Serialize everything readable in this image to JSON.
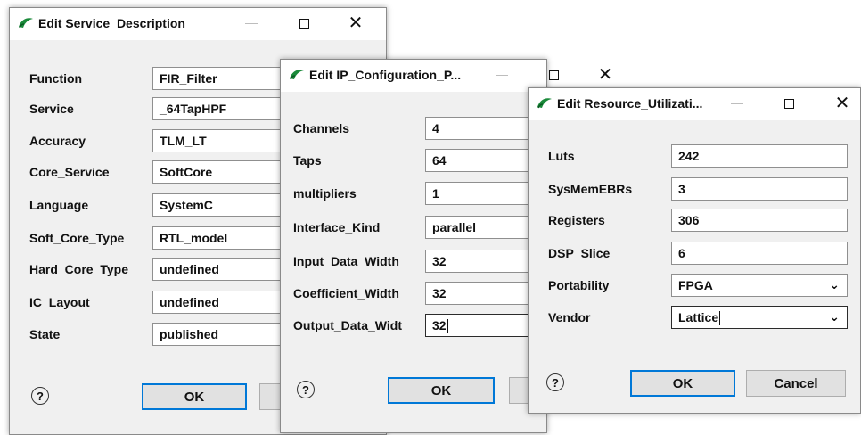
{
  "dialog1": {
    "title": "Edit Service_Description",
    "rows": [
      {
        "label": "Function",
        "value": "FIR_Filter"
      },
      {
        "label": "Service",
        "value": "_64TapHPF"
      },
      {
        "label": "Accuracy",
        "value": "TLM_LT"
      },
      {
        "label": "Core_Service",
        "value": "SoftCore"
      },
      {
        "label": "Language",
        "value": "SystemC"
      },
      {
        "label": "Soft_Core_Type",
        "value": "RTL_model"
      },
      {
        "label": "Hard_Core_Type",
        "value": "undefined"
      },
      {
        "label": "IC_Layout",
        "value": "undefined"
      },
      {
        "label": "State",
        "value": "published"
      }
    ],
    "help": "?",
    "ok_label": "OK"
  },
  "dialog2": {
    "title": "Edit IP_Configuration_P...",
    "rows": [
      {
        "label": "Channels",
        "value": "4"
      },
      {
        "label": "Taps",
        "value": "64"
      },
      {
        "label": "multipliers",
        "value": "1"
      },
      {
        "label": "Interface_Kind",
        "value": "parallel"
      },
      {
        "label": "Input_Data_Width",
        "value": "32"
      },
      {
        "label": "Coefficient_Width",
        "value": "32"
      },
      {
        "label": "Output_Data_Widt",
        "value": "32"
      }
    ],
    "help": "?",
    "ok_label": "OK"
  },
  "dialog3": {
    "title": "Edit Resource_Utilizati...",
    "rows": [
      {
        "label": "Luts",
        "value": "242"
      },
      {
        "label": "SysMemEBRs",
        "value": "3"
      },
      {
        "label": "Registers",
        "value": "306"
      },
      {
        "label": "DSP_Slice",
        "value": "6"
      },
      {
        "label": "Portability",
        "value": "FPGA"
      },
      {
        "label": "Vendor",
        "value": "Lattice"
      }
    ],
    "help": "?",
    "ok_label": "OK",
    "cancel_label": "Cancel"
  },
  "window_controls": {
    "close": "✕"
  },
  "icons": {
    "app": "green-swoosh-icon",
    "dropdown": "chevron-down-icon",
    "help": "help-icon"
  },
  "colors": {
    "accent": "#0078d7",
    "icon_green": "#1a8a3a"
  }
}
